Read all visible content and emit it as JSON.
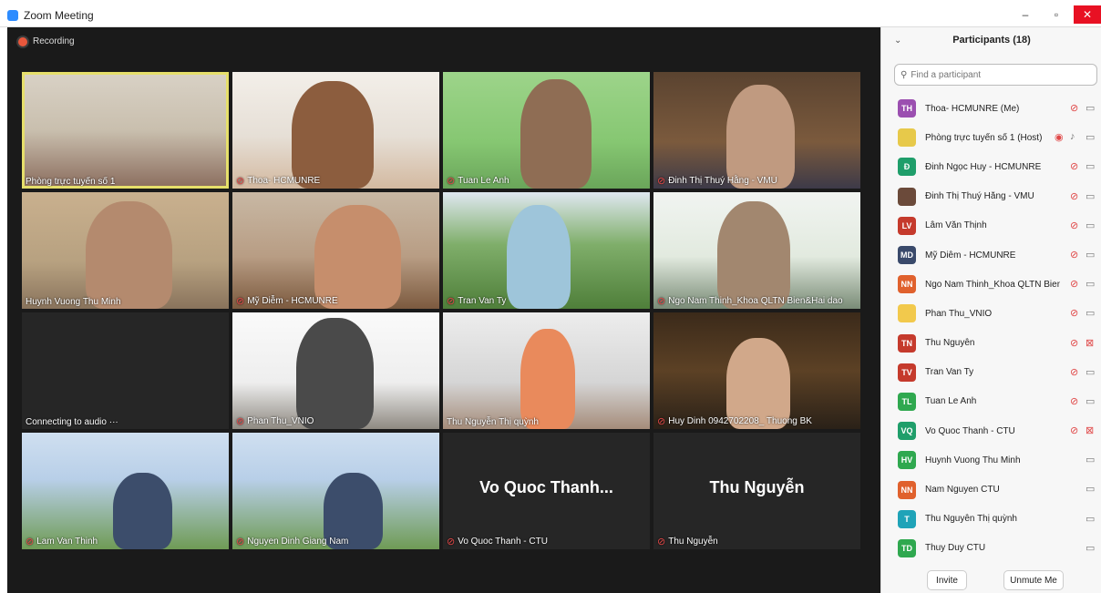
{
  "window": {
    "title": "Zoom Meeting",
    "minimize": "–",
    "maximize": "▫",
    "close": "✕"
  },
  "recording": {
    "label": "Recording"
  },
  "tiles": [
    {
      "name": "Phòng trực tuyến số 1",
      "muted": false,
      "bg": "office",
      "big": "",
      "active": true
    },
    {
      "name": "Thoa- HCMUNRE",
      "muted": true,
      "bg": "orange",
      "big": "",
      "active": false
    },
    {
      "name": "Tuan Le Anh",
      "muted": true,
      "bg": "green",
      "big": "",
      "active": false
    },
    {
      "name": "Đinh Thị Thuý Hằng - VMU",
      "muted": true,
      "bg": "brown",
      "big": "",
      "active": false
    },
    {
      "name": "Huynh Vuong Thu Minh",
      "muted": false,
      "bg": "wall",
      "big": "",
      "active": false
    },
    {
      "name": "Mỹ Diễm - HCMUNRE",
      "muted": true,
      "bg": "room",
      "big": "",
      "active": false
    },
    {
      "name": "Tran Van Ty",
      "muted": true,
      "bg": "campus",
      "big": "",
      "active": false
    },
    {
      "name": "Ngo Nam Thinh_Khoa QLTN Bien&Hai dao",
      "muted": true,
      "bg": "banner",
      "big": "",
      "active": false
    },
    {
      "name": "Connecting to audio ···",
      "muted": false,
      "bg": "dark",
      "big": "",
      "active": false
    },
    {
      "name": "Phan Thu_VNIO",
      "muted": true,
      "bg": "white",
      "big": "",
      "active": false
    },
    {
      "name": "Thu Nguyễn Thị quỳnh",
      "muted": false,
      "bg": "gray",
      "big": "",
      "active": false
    },
    {
      "name": "Huy Dinh 0942702208_ Thuong BK",
      "muted": true,
      "bg": "night",
      "big": "",
      "active": false
    },
    {
      "name": "Lam Van Thinh",
      "muted": true,
      "bg": "sky",
      "big": "",
      "active": false
    },
    {
      "name": "Nguyen Dinh Giang Nam",
      "muted": true,
      "bg": "sky",
      "big": "",
      "active": false
    },
    {
      "name": "Vo Quoc Thanh - CTU",
      "muted": true,
      "bg": "dark",
      "big": "Vo Quoc Thanh...",
      "active": false
    },
    {
      "name": "Thu Nguyễn",
      "muted": true,
      "bg": "dark",
      "big": "Thu Nguyễn",
      "active": false
    }
  ],
  "panel": {
    "title": "Participants (18)",
    "search_placeholder": "Find a participant",
    "participants": [
      {
        "initials": "TH",
        "color": "#9b4fb0",
        "name": "Thoa- HCMUNRE (Me)",
        "mic": "muted",
        "cam": "on",
        "rec": false
      },
      {
        "initials": "",
        "color": "#e7c94a",
        "name": "Phòng trực tuyến số 1 (Host)",
        "mic": "on",
        "cam": "on",
        "rec": true
      },
      {
        "initials": "Đ",
        "color": "#1f9e6a",
        "name": "Đinh Ngọc Huy - HCMUNRE",
        "mic": "muted",
        "cam": "on",
        "rec": false
      },
      {
        "initials": "",
        "color": "#6b4a3a",
        "name": "Đinh Thị Thuý Hằng - VMU",
        "mic": "muted",
        "cam": "on",
        "rec": false
      },
      {
        "initials": "LV",
        "color": "#c53a2c",
        "name": "Lâm Văn Thịnh",
        "mic": "muted",
        "cam": "on",
        "rec": false
      },
      {
        "initials": "MD",
        "color": "#3a4a6b",
        "name": "Mỹ Diễm - HCMUNRE",
        "mic": "muted",
        "cam": "on",
        "rec": false
      },
      {
        "initials": "NN",
        "color": "#e0612d",
        "name": "Ngo Nam Thinh_Khoa QLTN Bien...",
        "mic": "muted",
        "cam": "on",
        "rec": false
      },
      {
        "initials": "",
        "color": "#f2c94c",
        "name": "Phan Thu_VNIO",
        "mic": "muted",
        "cam": "on",
        "rec": false
      },
      {
        "initials": "TN",
        "color": "#c53a2c",
        "name": "Thu Nguyễn",
        "mic": "muted",
        "cam": "off",
        "rec": false
      },
      {
        "initials": "TV",
        "color": "#c53a2c",
        "name": "Tran Van Ty",
        "mic": "muted",
        "cam": "on",
        "rec": false
      },
      {
        "initials": "TL",
        "color": "#2fa84f",
        "name": "Tuan Le Anh",
        "mic": "muted",
        "cam": "on",
        "rec": false
      },
      {
        "initials": "VQ",
        "color": "#1f9e6a",
        "name": "Vo Quoc Thanh - CTU",
        "mic": "muted",
        "cam": "off",
        "rec": false
      },
      {
        "initials": "HV",
        "color": "#2fa84f",
        "name": "Huynh Vuong Thu Minh",
        "mic": "none",
        "cam": "on",
        "rec": false
      },
      {
        "initials": "NN",
        "color": "#e0612d",
        "name": "Nam Nguyen CTU",
        "mic": "none",
        "cam": "on",
        "rec": false
      },
      {
        "initials": "T",
        "color": "#1fa3b8",
        "name": "Thu Nguyễn Thị quỳnh",
        "mic": "none",
        "cam": "on",
        "rec": false
      },
      {
        "initials": "TD",
        "color": "#2fa84f",
        "name": "Thuy Duy CTU",
        "mic": "none",
        "cam": "on",
        "rec": false
      }
    ],
    "invite_label": "Invite",
    "unmute_label": "Unmute Me"
  }
}
